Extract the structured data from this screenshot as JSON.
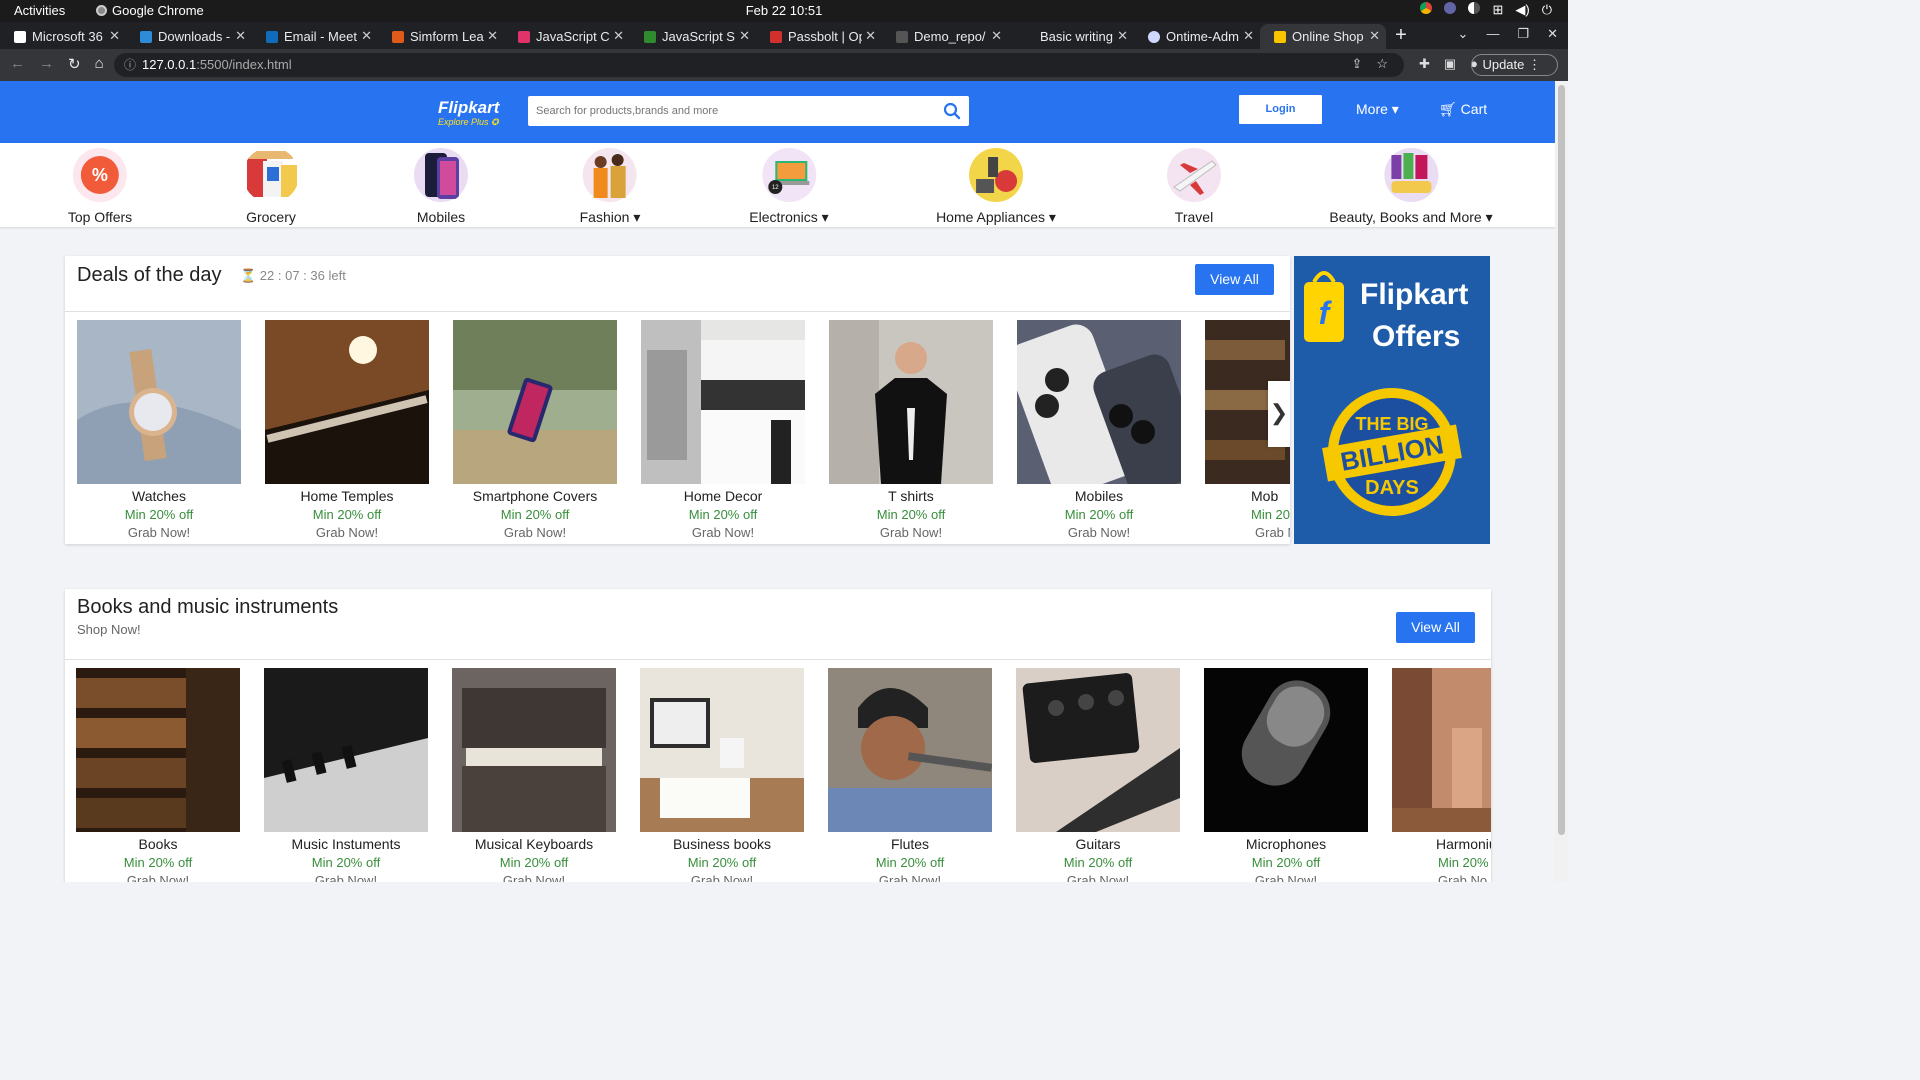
{
  "system": {
    "activities": "Activities",
    "app": "Google Chrome",
    "clock": "Feb 22  10:51"
  },
  "browser": {
    "tabs": [
      {
        "label": "Microsoft 36",
        "color": "#ffffff"
      },
      {
        "label": "Downloads -",
        "color": "#2d8bd8"
      },
      {
        "label": "Email - Meet",
        "color": "#0f6cbd"
      },
      {
        "label": "Simform Lea",
        "color": "#e05a1a"
      },
      {
        "label": "JavaScript C",
        "color": "#e0336a"
      },
      {
        "label": "JavaScript S",
        "color": "#2e8b2e"
      },
      {
        "label": "Passbolt | Op",
        "color": "#d0312d"
      },
      {
        "label": "Demo_repo/",
        "color": "#555555"
      },
      {
        "label": "Basic writing",
        "color": "#202124"
      },
      {
        "label": "Ontime-Adm",
        "color": "#cfd8ff"
      },
      {
        "label": "Online Shop",
        "color": "#f7c600"
      }
    ],
    "url_host": "127.0.0.1",
    "url_path": ":5500/index.html",
    "update_label": "Update"
  },
  "header": {
    "logo_name": "Flipkart",
    "logo_tag": "Explore Plus ✪",
    "search_placeholder": "Search for products,brands and more",
    "login": "Login",
    "more": "More ▾",
    "cart": "Cart"
  },
  "categories": [
    {
      "label": "Top Offers"
    },
    {
      "label": "Grocery"
    },
    {
      "label": "Mobiles"
    },
    {
      "label": "Fashion ▾"
    },
    {
      "label": "Electronics ▾"
    },
    {
      "label": "Home Appliances ▾"
    },
    {
      "label": "Travel"
    },
    {
      "label": "Beauty, Books and More ▾"
    }
  ],
  "deals": {
    "title": "Deals of the day",
    "timer": "⏳ 22 : 07 : 36 left",
    "view_all": "View All",
    "items": [
      {
        "name": "Watches",
        "offer": "Min 20% off",
        "cta": "Grab Now!"
      },
      {
        "name": "Home Temples",
        "offer": "Min 20% off",
        "cta": "Grab Now!"
      },
      {
        "name": "Smartphone Covers",
        "offer": "Min 20% off",
        "cta": "Grab Now!"
      },
      {
        "name": "Home Decor",
        "offer": "Min 20% off",
        "cta": "Grab Now!"
      },
      {
        "name": "T shirts",
        "offer": "Min 20% off",
        "cta": "Grab Now!"
      },
      {
        "name": "Mobiles",
        "offer": "Min 20% off",
        "cta": "Grab Now!"
      },
      {
        "name": "Mob",
        "offer": "Min 20",
        "cta": "Grab N"
      }
    ]
  },
  "offers_banner": {
    "brand": "Flipkart",
    "word": "Offers",
    "line1": "THE BIG",
    "line2": "BILLION",
    "line3": "DAYS"
  },
  "books": {
    "title": "Books and music instruments",
    "subtitle": "Shop Now!",
    "view_all": "View All",
    "items": [
      {
        "name": "Books",
        "offer": "Min 20% off",
        "cta": "Grab Now!"
      },
      {
        "name": "Music Instuments",
        "offer": "Min 20% off",
        "cta": "Grab Now!"
      },
      {
        "name": "Musical Keyboards",
        "offer": "Min 20% off",
        "cta": "Grab Now!"
      },
      {
        "name": "Business books",
        "offer": "Min 20% off",
        "cta": "Grab Now!"
      },
      {
        "name": "Flutes",
        "offer": "Min 20% off",
        "cta": "Grab Now!"
      },
      {
        "name": "Guitars",
        "offer": "Min 20% off",
        "cta": "Grab Now!"
      },
      {
        "name": "Microphones",
        "offer": "Min 20% off",
        "cta": "Grab Now!"
      },
      {
        "name": "Harmoniu",
        "offer": "Min 20%",
        "cta": "Grab No"
      }
    ]
  }
}
